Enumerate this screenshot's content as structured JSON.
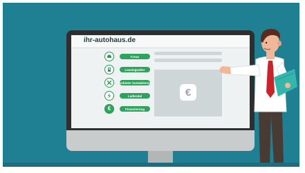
{
  "website": {
    "url": "ihr-autohaus.de"
  },
  "menu": [
    {
      "icon": "car-icon",
      "label": "F.Aus"
    },
    {
      "icon": "car-door-icon",
      "label": "Leasingsalter"
    },
    {
      "icon": "tools-icon",
      "label": "Anbieter kontaktieren"
    },
    {
      "icon": "lightning-icon",
      "label": "Laderatal"
    },
    {
      "icon": "euro-icon",
      "label": "Finanzierung"
    }
  ],
  "panel": {
    "symbol": "€"
  },
  "colors": {
    "background": "#1f7f93",
    "accent_green": "#2ea35b",
    "monitor_frame": "#2e2e2e",
    "screen": "#eef2f2"
  }
}
